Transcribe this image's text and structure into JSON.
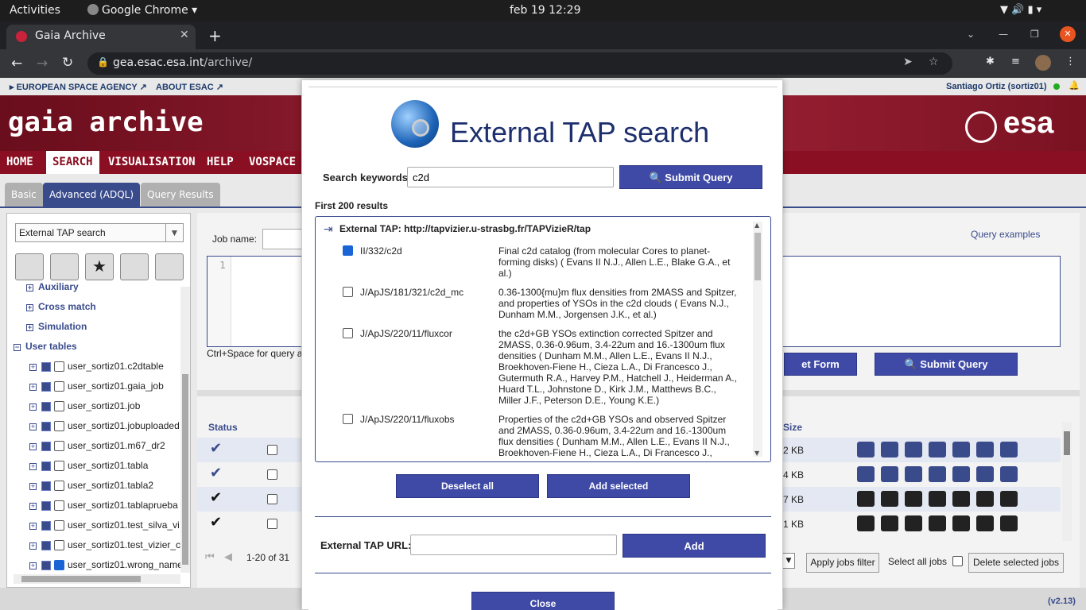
{
  "os": {
    "activities": "Activities",
    "app": "Google Chrome",
    "clock": "feb 19  12:29"
  },
  "browser": {
    "tab_title": "Gaia Archive",
    "url_host": "gea.esac.esa.int",
    "url_path": "/archive/"
  },
  "esa_strip": {
    "agency": "EUROPEAN SPACE AGENCY",
    "about": "ABOUT ESAC",
    "user": "Santiago Ortiz (sortiz01)"
  },
  "site": {
    "title": "gaia archive",
    "esa_logo": "esa",
    "version": "(v2.13)"
  },
  "nav": [
    "HOME",
    "SEARCH",
    "VISUALISATION",
    "HELP",
    "VOSPACE"
  ],
  "subtabs": [
    "Basic",
    "Advanced (ADQL)",
    "Query Results"
  ],
  "left": {
    "select_value": "External TAP search",
    "tree": [
      {
        "label": "Auxiliary",
        "kind": "group"
      },
      {
        "label": "Cross match",
        "kind": "group"
      },
      {
        "label": "Simulation",
        "kind": "group"
      }
    ],
    "user_tables_label": "User tables",
    "tables": [
      {
        "label": "user_sortiz01.c2dtable",
        "checked": false
      },
      {
        "label": "user_sortiz01.gaia_job",
        "checked": false
      },
      {
        "label": "user_sortiz01.job",
        "checked": false
      },
      {
        "label": "user_sortiz01.jobuploaded",
        "checked": false
      },
      {
        "label": "user_sortiz01.m67_dr2",
        "checked": false
      },
      {
        "label": "user_sortiz01.tabla",
        "checked": false
      },
      {
        "label": "user_sortiz01.tabla2",
        "checked": false
      },
      {
        "label": "user_sortiz01.tablaprueba",
        "checked": false
      },
      {
        "label": "user_sortiz01.test_silva_vi",
        "checked": false
      },
      {
        "label": "user_sortiz01.test_vizier_c",
        "checked": false
      },
      {
        "label": "user_sortiz01.wrong_name",
        "checked": true
      }
    ]
  },
  "right": {
    "job_name_label": "Job name:",
    "query_examples": "Query examples",
    "line_number": "1",
    "hint": "Ctrl+Space for query a",
    "reset_form": "et Form",
    "submit_query": "Submit Query",
    "status_header": "Status",
    "size_header": "Size",
    "sizes": [
      "2 KB",
      "4 KB",
      "7 KB",
      "1 KB"
    ],
    "pagination": "1-20 of 31",
    "apply_filter": "Apply jobs filter",
    "select_all_jobs": "Select all jobs",
    "delete_selected": "Delete selected jobs"
  },
  "modal": {
    "title": "External TAP search",
    "search_label": "Search keywords",
    "search_value": "c2d",
    "submit_label": "Submit Query",
    "results_count": "First 200 results",
    "service_label": "External TAP: http://tapvizier.u-strasbg.fr/TAPVizieR/tap",
    "results": [
      {
        "id": "II/332/c2d",
        "checked": true,
        "desc": "Final c2d catalog (from molecular Cores to planet-forming disks) ( Evans II N.J., Allen L.E., Blake G.A., et al.)"
      },
      {
        "id": "J/ApJS/181/321/c2d_mc",
        "checked": false,
        "desc": "0.36-1300{mu}m flux densities from 2MASS and Spitzer, and properties of YSOs in the c2d clouds ( Evans N.J., Dunham M.M., Jorgensen J.K., et al.)"
      },
      {
        "id": "J/ApJS/220/11/fluxcor",
        "checked": false,
        "desc": "the c2d+GB YSOs extinction corrected Spitzer and 2MASS, 0.36-0.96um, 3.4-22um and 16.-1300um flux densities ( Dunham M.M., Allen L.E., Evans II N.J., Broekhoven-Fiene H., Cieza L.A., Di Francesco J., Gutermuth R.A., Harvey P.M., Hatchell J., Heiderman A., Huard T.L., Johnstone D., Kirk J.M., Matthews B.C., Miller J.F., Peterson D.E., Young K.E.)"
      },
      {
        "id": "J/ApJS/220/11/fluxobs",
        "checked": false,
        "desc": "Properties of the c2d+GB YSOs and observed Spitzer and 2MASS, 0.36-0.96um, 3.4-22um and 16.-1300um flux densities ( Dunham M.M., Allen L.E., Evans II N.J., Broekhoven-Fiene H., Cieza L.A., Di Francesco J.,"
      }
    ],
    "deselect_all": "Deselect all",
    "add_selected": "Add selected",
    "tap_url_label": "External TAP URL:",
    "tap_url_value": "",
    "add_label": "Add",
    "close_label": "Close"
  }
}
